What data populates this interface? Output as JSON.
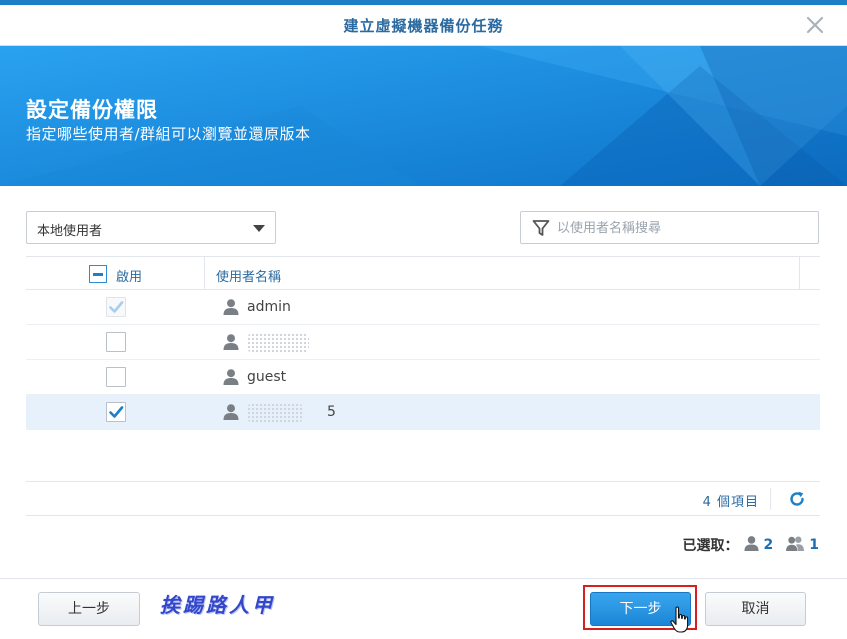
{
  "window": {
    "title": "建立虛擬機器備份任務",
    "close_icon": "close-icon"
  },
  "banner": {
    "title": "設定備份權限",
    "subtitle": "指定哪些使用者/群組可以瀏覽並還原版本"
  },
  "filter": {
    "user_type_value": "本地使用者",
    "search_placeholder": "以使用者名稱搜尋"
  },
  "grid": {
    "columns": [
      "啟用",
      "使用者名稱"
    ],
    "rows": [
      {
        "name": "admin",
        "checked": true,
        "disabled": true,
        "selected": false,
        "obscured": false
      },
      {
        "name": "",
        "checked": false,
        "disabled": false,
        "selected": false,
        "obscured": true
      },
      {
        "name": "guest",
        "checked": false,
        "disabled": false,
        "selected": false,
        "obscured": false
      },
      {
        "name": "5",
        "checked": true,
        "disabled": false,
        "selected": true,
        "obscured": true
      }
    ]
  },
  "footer": {
    "item_count": "4 個項目",
    "selected_label": "已選取：",
    "selected_users": "2",
    "selected_groups": "1"
  },
  "buttons": {
    "prev": "上一步",
    "next": "下一步",
    "cancel": "取消"
  },
  "watermark": "挨踢路人甲",
  "colors": {
    "accent": "#1d7fc6",
    "banner": "#1c8fe0",
    "highlight": "#d62020",
    "header_text": "#2b6aa0"
  }
}
